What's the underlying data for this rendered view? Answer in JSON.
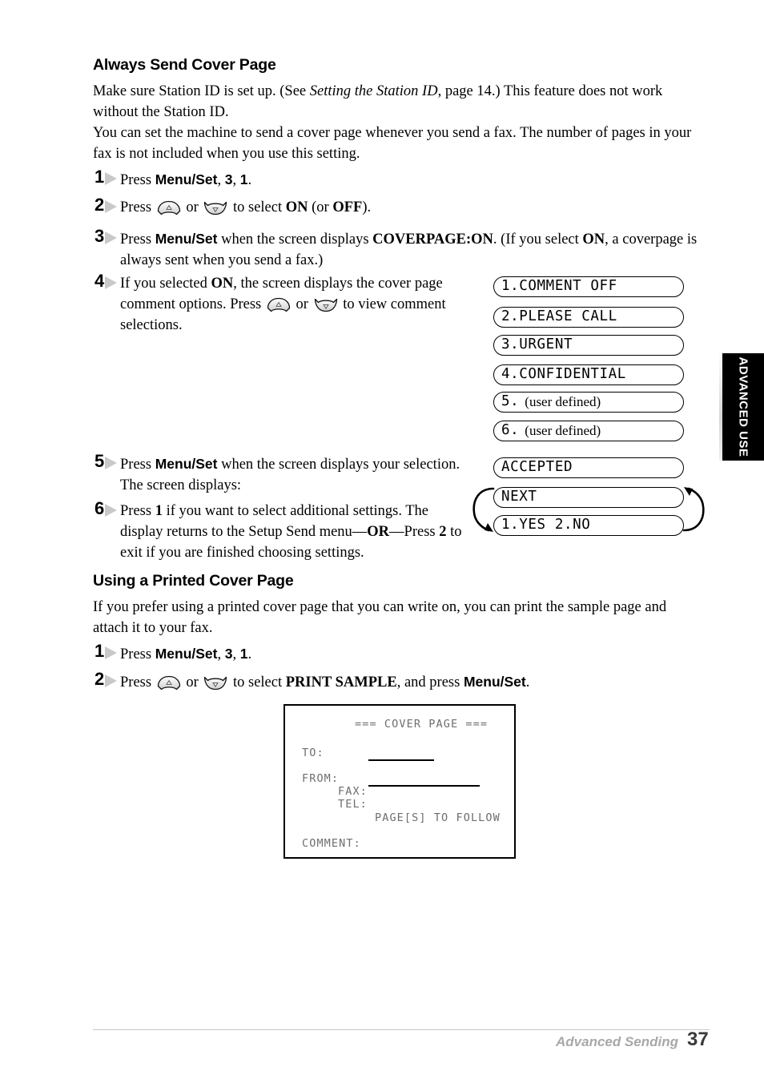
{
  "page": {
    "number": "37",
    "footer_section": "Advanced Sending",
    "side_tab": "ADVANCED USE"
  },
  "section1": {
    "heading": "Always Send Cover Page",
    "para1_a": "Make sure Station ID is set up. (See ",
    "para1_italic": "Setting the Station ID",
    "para1_b": ", page 14.) This feature does not work without the Station ID.",
    "para2": "You can set the machine to send a cover page whenever you send a fax. The number of pages in your fax is not included when you use this setting.",
    "steps": [
      {
        "num": "1",
        "text_html": "Press <b class=\"bs\">Menu/Set</b>, <b class=\"bs\">3</b>, <b class=\"bs\">1</b>."
      },
      {
        "num": "2",
        "text_html": "Press KEYUP or KEYDOWN to select <b class=\"b\">ON</b> (or <b class=\"b\">OFF</b>)."
      },
      {
        "num": "3",
        "text_html": "Press <b class=\"bs\">Menu/Set</b> when the screen displays <b class=\"b\">COVERPAGE:ON</b>. (If you select <b class=\"b\">ON</b>, a coverpage is always sent when you send a fax.)"
      },
      {
        "num": "4",
        "text_html": "If you selected <b class=\"b\">ON</b>, the screen displays the cover page comment options. Press KEYUP or KEYDOWN to view comment selections."
      },
      {
        "num": "5",
        "text_html": "Press <b class=\"bs\">Menu/Set</b> when the screen displays your selection. The screen displays:"
      },
      {
        "num": "6",
        "text_html": "Press <b class=\"b\">1</b> if you want to select additional settings. The display returns to the Setup Send menu&mdash;<b class=\"b\">OR</b>&mdash;Press <b class=\"b\">2</b> to exit if you are finished choosing settings."
      }
    ]
  },
  "lcd_comment_options": [
    {
      "mono": "1.COMMENT OFF",
      "serif": ""
    },
    {
      "mono": "2.PLEASE CALL",
      "serif": ""
    },
    {
      "mono": "3.URGENT",
      "serif": ""
    },
    {
      "mono": "4.CONFIDENTIAL",
      "serif": ""
    },
    {
      "mono": "5.",
      "serif": "(user defined)"
    },
    {
      "mono": "6.",
      "serif": "(user defined)"
    }
  ],
  "lcd_confirm": [
    {
      "mono": "ACCEPTED",
      "serif": ""
    },
    {
      "mono": "NEXT",
      "serif": ""
    },
    {
      "mono": "1.YES 2.NO",
      "serif": ""
    }
  ],
  "section2": {
    "heading": "Using a Printed Cover Page",
    "para1": "If you prefer using a printed cover page that you can write on, you can print the sample page and attach it to your fax.",
    "steps": [
      {
        "num": "1",
        "text_html": "Press <b class=\"bs\">Menu/Set</b>, <b class=\"bs\">3</b>, <b class=\"bs\">1</b>."
      },
      {
        "num": "2",
        "text_html": "Press KEYUP or KEYDOWN to select <b class=\"b\">PRINT SAMPLE</b>, and press <b class=\"bs\">Menu/Set</b>."
      }
    ]
  },
  "cover_sample": {
    "title": "=== COVER PAGE ===",
    "to_label": "TO:",
    "from_label": "FROM:",
    "fax_label": "FAX:",
    "tel_label": "TEL:",
    "pages_label": "PAGE[S] TO FOLLOW",
    "comment_label": "COMMENT:"
  },
  "colors": {
    "text": "#000000",
    "cover_text": "#6e6e6e",
    "footer_rule": "#c6c6c6",
    "footer_section": "#a8a8a8",
    "step_wedge": "#c9c9c9"
  }
}
